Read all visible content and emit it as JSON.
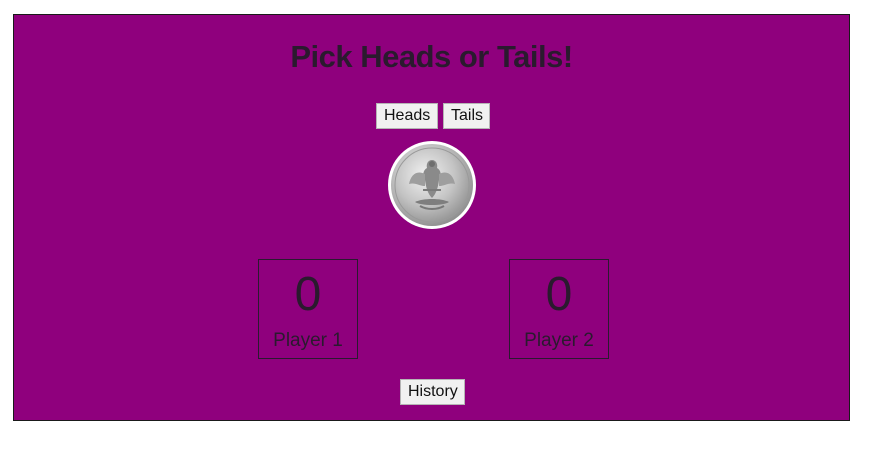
{
  "game": {
    "title": "Pick Heads or Tails!",
    "buttons": {
      "heads_label": "Heads",
      "tails_label": "Tails",
      "history_label": "History"
    },
    "coin": {
      "face": "tails",
      "icon": "quarter-coin-eagle-icon"
    },
    "players": [
      {
        "label": "Player 1",
        "score": "0"
      },
      {
        "label": "Player 2",
        "score": "0"
      }
    ]
  },
  "colors": {
    "background": "#8f007d",
    "text": "#2a1a2e",
    "button_bg": "#f1f1f1"
  }
}
